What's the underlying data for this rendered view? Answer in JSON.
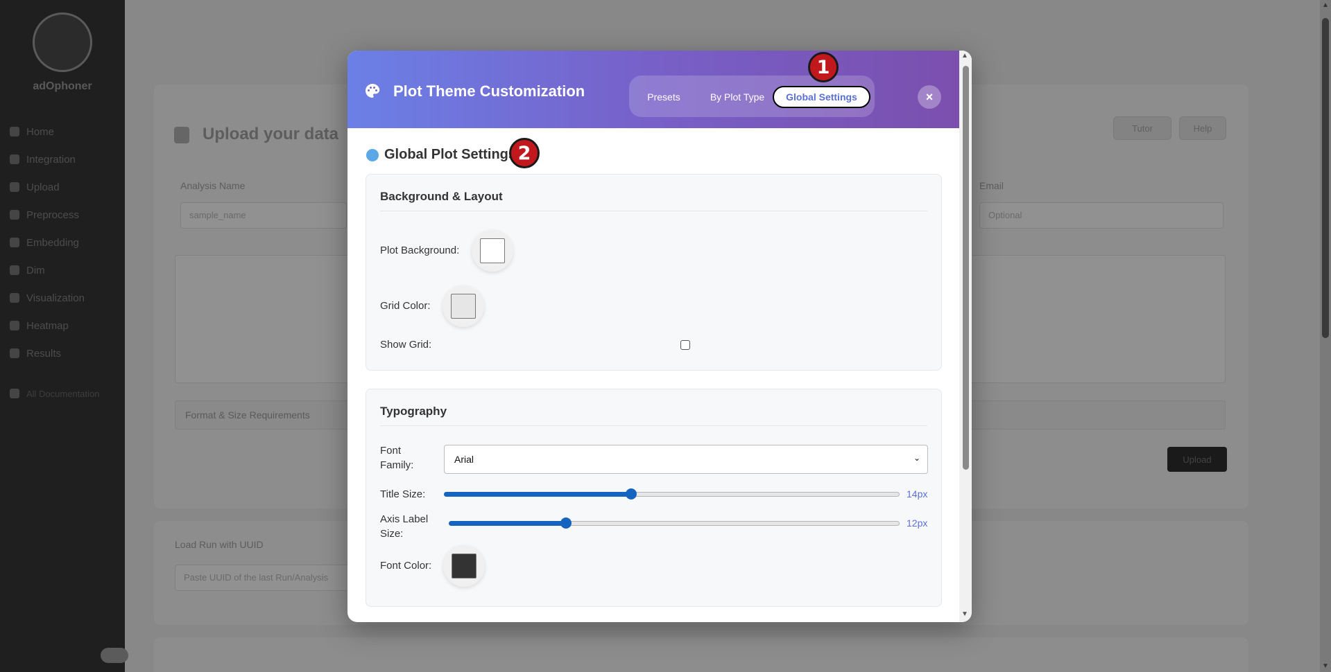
{
  "background": {
    "brand": "adOphoner",
    "nav": [
      "Home",
      "Integration",
      "Upload",
      "Preprocess",
      "Embedding",
      "Dim",
      "Visualization",
      "Heatmap",
      "Results"
    ],
    "nav_footer": "All Documentation",
    "page_title": "Upload your data",
    "buttons": [
      "Tutor",
      "Help"
    ],
    "analysis_name_label": "Analysis Name",
    "analysis_name_value": "sample_name",
    "email_label": "Email",
    "email_placeholder": "Optional",
    "accordion": "Format & Size Requirements",
    "run_button": "Upload",
    "load_label": "Load Run with UUID",
    "load_placeholder": "Paste UUID of the last Run/Analysis"
  },
  "modal": {
    "title": "Plot Theme Customization",
    "tabs": [
      {
        "label": "Presets"
      },
      {
        "label": "By Plot Type"
      },
      {
        "label": "Global Settings"
      }
    ],
    "active_tab": "Global Settings",
    "close": "×",
    "section_title": "Global Plot Settings",
    "background_layout": {
      "heading": "Background & Layout",
      "plot_background_label": "Plot Background:",
      "plot_background_color": "#ffffff",
      "grid_color_label": "Grid Color:",
      "grid_color": "#e6e6e6",
      "show_grid_label": "Show Grid:",
      "show_grid": false
    },
    "typography": {
      "heading": "Typography",
      "font_family_label_1": "Font",
      "font_family_label_2": "Family:",
      "font_family_value": "Arial",
      "title_size_label": "Title Size:",
      "title_size_value": "14px",
      "title_size_fraction": 0.41,
      "axis_label_label_1": "Axis Label",
      "axis_label_label_2": "Size:",
      "axis_label_value": "12px",
      "axis_label_fraction": 0.26,
      "font_color_label": "Font Color:",
      "font_color": "#333333"
    }
  },
  "markers": [
    "1",
    "2"
  ],
  "colors": {
    "header_start": "#6b80e6",
    "header_end": "#7b4fae",
    "accent": "#5a6fd6",
    "slider": "#1565c0",
    "marker": "#c0181c"
  }
}
